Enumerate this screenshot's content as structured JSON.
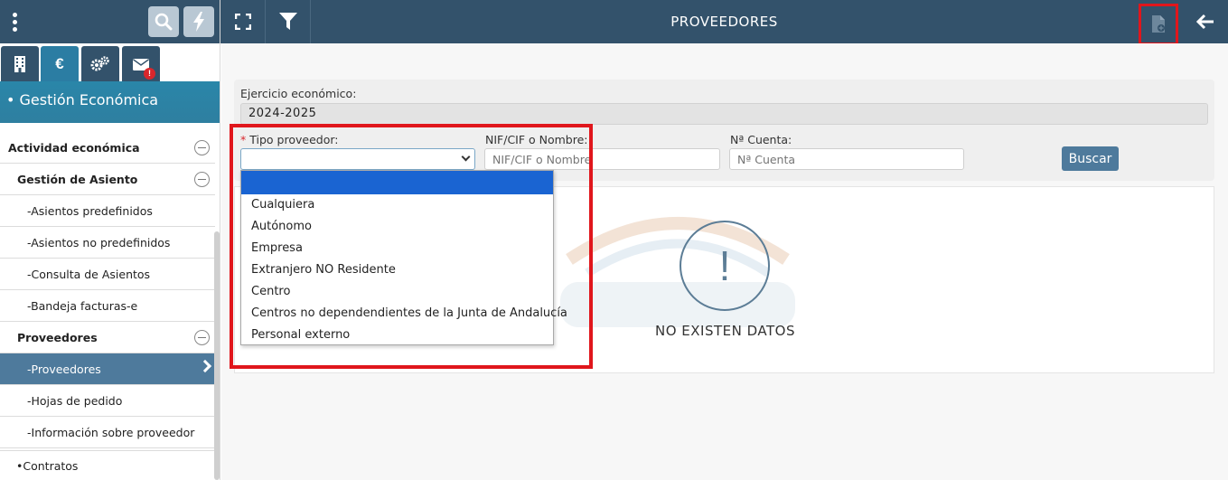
{
  "sidebar": {
    "section_title": "• Gestión Económica",
    "nav": [
      {
        "label": "Actividad económica"
      },
      {
        "label": "Gestión de Asiento"
      },
      {
        "label": "-Asientos predefinidos"
      },
      {
        "label": "-Asientos no predefinidos"
      },
      {
        "label": "-Consulta de Asientos"
      },
      {
        "label": "-Bandeja facturas-e"
      },
      {
        "label": "Proveedores"
      },
      {
        "label": "-Proveedores"
      },
      {
        "label": "-Hojas de pedido"
      },
      {
        "label": "-Información sobre proveedor"
      }
    ],
    "contratos": "•Contratos",
    "tab_currency_symbol": "€",
    "badge": "!"
  },
  "header": {
    "title": "PROVEEDORES"
  },
  "form": {
    "ejercicio_label": "Ejercicio económico:",
    "ejercicio_value": "2024-2025",
    "required_mark": "*",
    "tipo_label": "Tipo proveedor:",
    "nif_label": "NIF/CIF o Nombre:",
    "nif_placeholder": "NIF/CIF o Nombre",
    "cuenta_label": "Nª Cuenta:",
    "cuenta_placeholder": "Nª Cuenta",
    "buscar_label": "Buscar"
  },
  "dropdown": {
    "options": [
      "Cualquiera",
      "Autónomo",
      "Empresa",
      "Extranjero NO Residente",
      "Centro",
      "Centros no dependendientes de la Junta de Andalucía",
      "Personal externo"
    ]
  },
  "results": {
    "empty_icon": "!",
    "empty_text": "NO EXISTEN DATOS"
  },
  "colors": {
    "header_bg": "#33526b",
    "accent": "#2b7da3",
    "active_item": "#4e7a9c",
    "highlight": "#e0161c",
    "selected_option": "#1a64d2"
  }
}
